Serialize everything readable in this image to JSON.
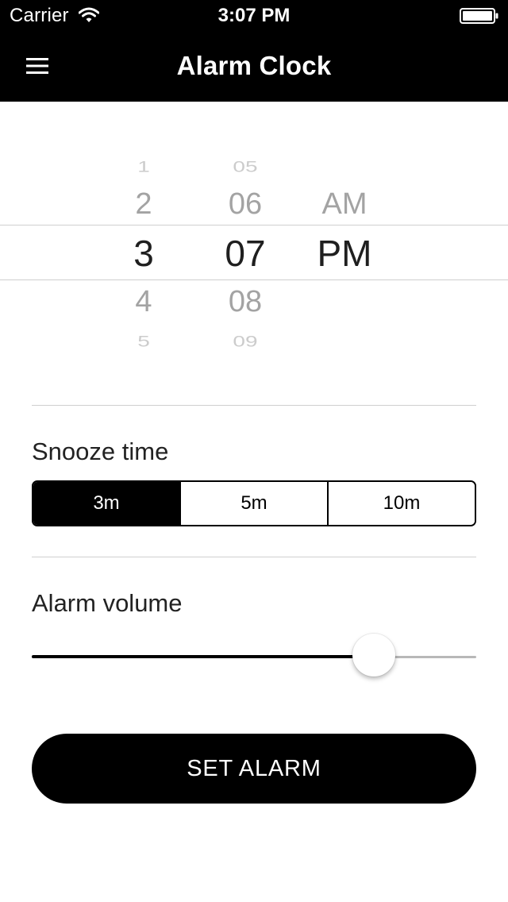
{
  "status_bar": {
    "carrier": "Carrier",
    "time": "3:07 PM",
    "wifi_icon": "wifi-icon",
    "battery_icon": "battery-icon"
  },
  "nav": {
    "title": "Alarm Clock",
    "menu_icon": "hamburger-menu-icon"
  },
  "picker": {
    "hours": [
      "1",
      "2",
      "3",
      "4",
      "5"
    ],
    "minutes": [
      "05",
      "06",
      "07",
      "08",
      "09"
    ],
    "periods": [
      "AM",
      "PM"
    ],
    "selected_hour": "3",
    "selected_minute": "07",
    "selected_period": "PM"
  },
  "snooze": {
    "label": "Snooze time",
    "options": [
      "3m",
      "5m",
      "10m"
    ],
    "selected": "3m"
  },
  "volume": {
    "label": "Alarm volume",
    "level_percent": 77
  },
  "set_button": {
    "label": "SET ALARM"
  },
  "colors": {
    "bar_background": "#000000",
    "accent": "#000000",
    "selected_text": "#1f1f1f",
    "faded_text": "#a3a3a3",
    "track": "#b8b8b8"
  }
}
